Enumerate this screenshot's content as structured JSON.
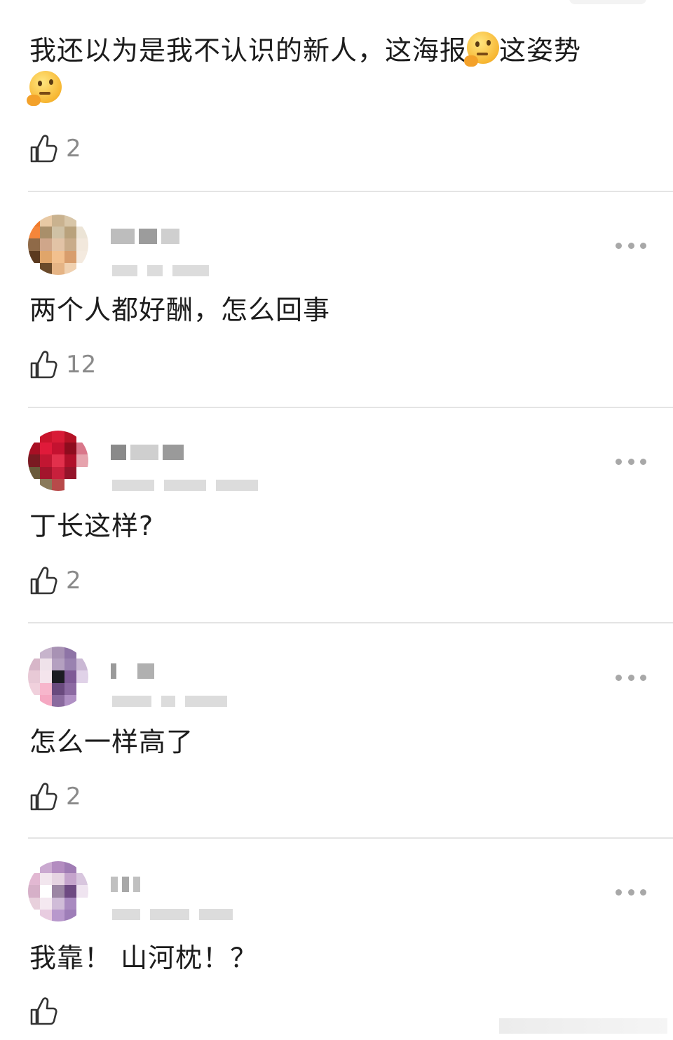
{
  "comments": [
    {
      "text_before": "我还以为是我不认识的新人，这海报",
      "emoji_1": "thinking-face",
      "text_middle": "这姿势",
      "emoji_2": "thinking-face",
      "likes": "2"
    },
    {
      "text": "两个人都好酬，怎么回事",
      "likes": "12"
    },
    {
      "text": "丁长这样?",
      "likes": "2"
    },
    {
      "text": "怎么一样高了",
      "likes": "2"
    },
    {
      "text": "我靠！ 山河枕！？",
      "likes": ""
    }
  ],
  "icons": {
    "like": "thumbs-up-icon",
    "more": "more-dots-icon"
  },
  "colors": {
    "text": "#1c1c1c",
    "muted": "#8a8a8a",
    "divider": "#e4e4e4"
  }
}
